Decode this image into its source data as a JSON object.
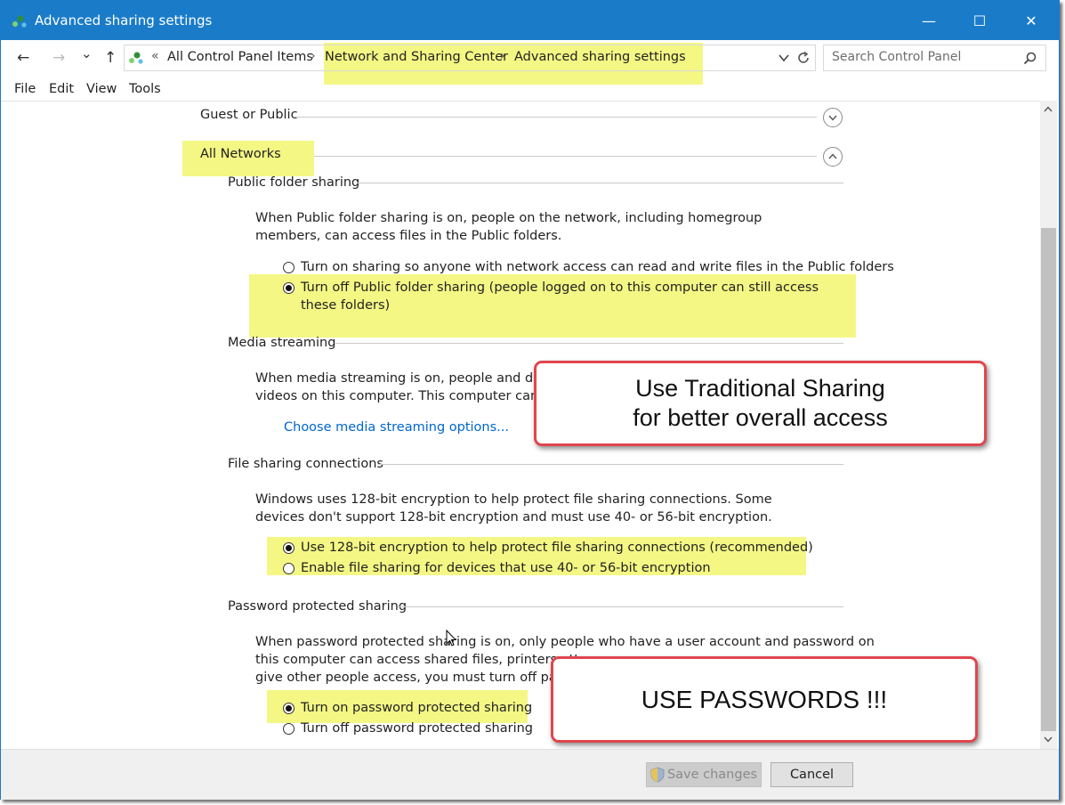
{
  "window": {
    "title": "Advanced sharing settings",
    "controls": {
      "minimize": "—",
      "maximize": "☐",
      "close": "✕"
    }
  },
  "nav": {
    "back": "←",
    "forward": "→",
    "dropdown": "⌄",
    "up": "↑",
    "breadcrumb": {
      "overflow": "«",
      "items": [
        "All Control Panel Items",
        "Network and Sharing Center",
        "Advanced sharing settings"
      ],
      "separator": "›"
    },
    "search_placeholder": "Search Control Panel"
  },
  "menu": [
    "File",
    "Edit",
    "View",
    "Tools"
  ],
  "groups": {
    "guest": "Guest or Public",
    "all": "All Networks"
  },
  "public_folder": {
    "heading": "Public folder sharing",
    "description": "When Public folder sharing is on, people on the network, including homegroup members, can access files in the Public folders.",
    "option_on": "Turn on sharing so anyone with network access can read and write files in the Public folders",
    "option_off": "Turn off Public folder sharing (people logged on to this computer can still access these folders)"
  },
  "media": {
    "heading": "Media streaming",
    "description_line1": "When media streaming is on, people and devic",
    "description_line2": "videos on this computer. This computer can also",
    "link": "Choose media streaming options..."
  },
  "file_sharing": {
    "heading": "File sharing connections",
    "description": "Windows uses 128-bit encryption to help protect file sharing connections. Some devices don't support 128-bit encryption and must use 40- or 56-bit encryption.",
    "option_128": "Use 128-bit encryption to help protect file sharing connections (recommended)",
    "option_40_56": "Enable file sharing for devices that use 40- or 56-bit encryption"
  },
  "password": {
    "heading": "Password protected sharing",
    "description_line1": "When password protected sharing is on, only people who have a user account and password on",
    "description_line2": "this computer can access shared files, printers attac",
    "description_line3": "give other people access, you must turn off passwo",
    "option_on": "Turn on password protected sharing",
    "option_off": "Turn off password protected sharing"
  },
  "callouts": {
    "traditional_line1": "Use Traditional Sharing",
    "traditional_line2": "for better overall access",
    "passwords": "USE PASSWORDS !!!"
  },
  "footer": {
    "save": "Save changes",
    "cancel": "Cancel"
  },
  "colors": {
    "titlebar": "#1a7cc9",
    "highlight": "#f4f784",
    "callout_border": "#e0464e",
    "link": "#0066cc"
  }
}
